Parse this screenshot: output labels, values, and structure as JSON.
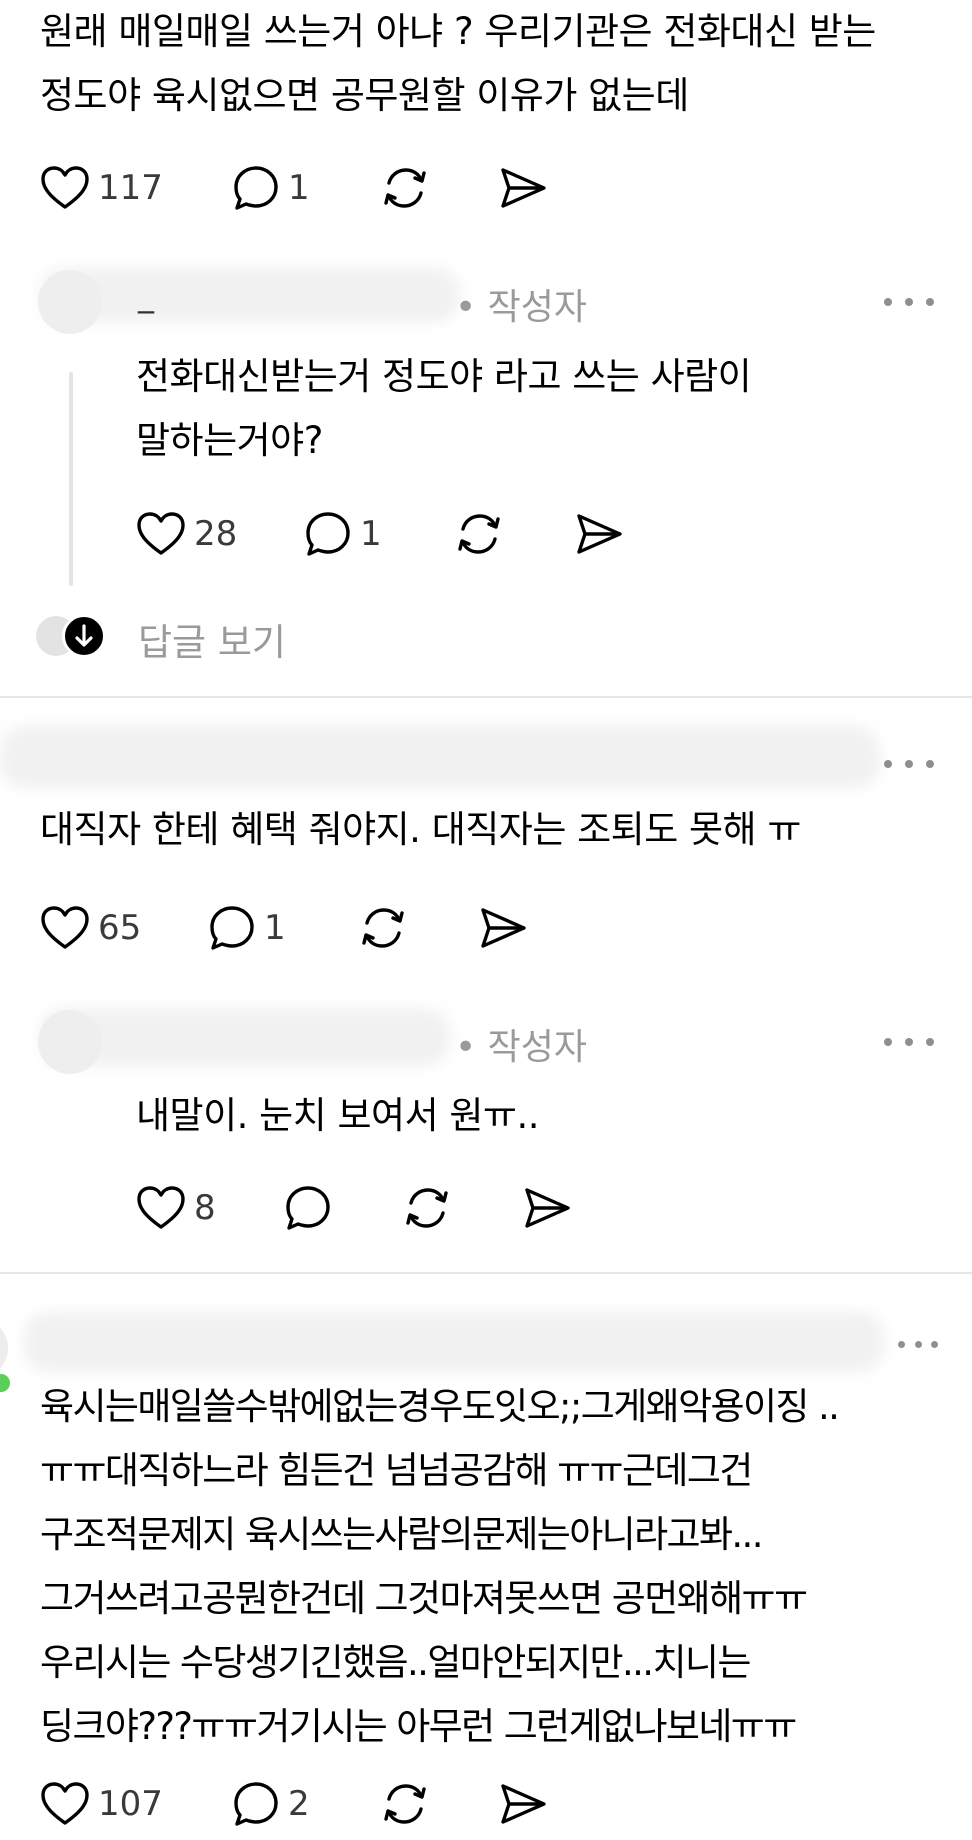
{
  "comment1": {
    "lines": [
      "원래 매일매일 쓰는거 아냐 ? 우리기관은 전화대신 받는",
      "정도야 육시없으면 공무원할 이유가 없는데"
    ],
    "likes": "117",
    "replies": "1"
  },
  "reply1": {
    "author_fragment": "_",
    "author_badge": "• 작성자",
    "lines": [
      "전화대신받는거 정도야 라고 쓰는 사람이",
      "말하는거야?"
    ],
    "likes": "28",
    "replies": "1"
  },
  "view_replies_label": "답글 보기",
  "comment2": {
    "lines": [
      "대직자 한테 혜택 줘야지. 대직자는 조퇴도 못해 ㅠ"
    ],
    "likes": "65",
    "replies": "1"
  },
  "reply2": {
    "author_badge": "• 작성자",
    "lines": [
      "내말이. 눈치 보여서 원ㅠ.."
    ],
    "likes": "8",
    "replies": ""
  },
  "comment3": {
    "lines": [
      "육시는매일쓸수밖에없는경우도잇오;;그게왜악용이징 ..",
      "ㅠㅠ대직하느라 힘든건 넘넘공감해 ㅠㅠ근데그건",
      "구조적문제지 육시쓰는사람의문제는아니라고봐...",
      "그거쓰려고공뭔한건데 그것마져못쓰면 공먼왜해ㅠㅠ",
      "우리시는 수당생기긴했음..얼마안되지만...치니는",
      "딩크야???ㅠㅠ거기시는 아무런 그런게없나보네ㅠㅠ"
    ],
    "likes": "107",
    "replies": "2"
  },
  "icons": [
    "heart-icon",
    "comment-icon",
    "repost-icon",
    "share-icon",
    "more-icon",
    "arrow-down-icon"
  ],
  "colors": {
    "text": "#000000",
    "muted": "#9a9a9a",
    "count": "#3a3a3a",
    "divider": "#e6e6e6",
    "online": "#5ad05a"
  }
}
